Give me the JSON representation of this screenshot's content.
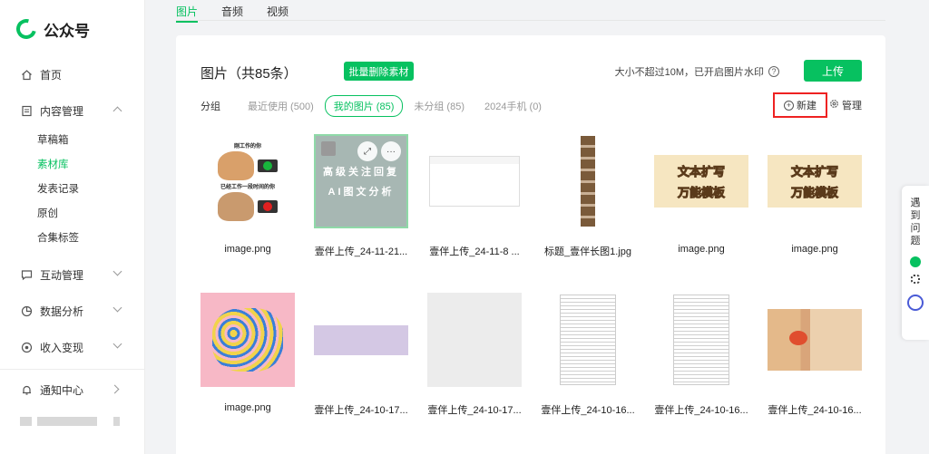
{
  "app": {
    "name": "公众号"
  },
  "sidebar": {
    "items": [
      {
        "label": "首页",
        "icon": "home-icon"
      },
      {
        "label": "内容管理",
        "icon": "document-icon",
        "expanded": true,
        "children": [
          "草稿箱",
          "素材库",
          "发表记录",
          "原创",
          "合集标签"
        ],
        "active_child": "素材库"
      },
      {
        "label": "互动管理",
        "icon": "chat-icon"
      },
      {
        "label": "数据分析",
        "icon": "chart-icon"
      },
      {
        "label": "收入变现",
        "icon": "money-icon"
      },
      {
        "label": "通知中心",
        "icon": "bell-icon"
      }
    ]
  },
  "top_tabs": [
    "图片",
    "音频",
    "视频"
  ],
  "active_top_tab": "图片",
  "header": {
    "title": "图片（共85条）",
    "batch_delete_label": "批量删除素材",
    "size_note": "大小不超过10M，已开启图片水印",
    "upload_label": "上传"
  },
  "groups": {
    "label": "分组",
    "tabs": [
      {
        "label": "最近使用 (500)",
        "active": false
      },
      {
        "label": "我的图片 (85)",
        "active": true
      },
      {
        "label": "未分组 (85)",
        "active": false
      },
      {
        "label": "2024手机 (0)",
        "active": false
      }
    ],
    "new_label": "新建",
    "manage_label": "管理"
  },
  "images": [
    {
      "name": "image.png",
      "kind": "meme",
      "top_caption": "刚工作的你",
      "bottom_caption": "已经工作一段时间的你"
    },
    {
      "name": "壹伴上传_24-11-21...",
      "kind": "selected",
      "line1": "高级关注回复",
      "line2": "AI图文分析"
    },
    {
      "name": "壹伴上传_24-11-8 ...",
      "kind": "screen"
    },
    {
      "name": "标题_壹伴长图1.jpg",
      "kind": "long"
    },
    {
      "name": "image.png",
      "kind": "banner",
      "line1": "文本扩写",
      "line2": "万能模板"
    },
    {
      "name": "image.png",
      "kind": "banner",
      "line1": "文本扩写",
      "line2": "万能模板"
    },
    {
      "name": "image.png",
      "kind": "pink"
    },
    {
      "name": "壹伴上传_24-10-17...",
      "kind": "lavender"
    },
    {
      "name": "壹伴上传_24-10-17...",
      "kind": "grey"
    },
    {
      "name": "壹伴上传_24-10-16...",
      "kind": "table"
    },
    {
      "name": "壹伴上传_24-10-16...",
      "kind": "table"
    },
    {
      "name": "壹伴上传_24-10-16...",
      "kind": "photo"
    }
  ],
  "float_widget": {
    "text": "遇到问题"
  },
  "colors": {
    "accent": "#07c160",
    "highlight_border": "#e22222"
  }
}
